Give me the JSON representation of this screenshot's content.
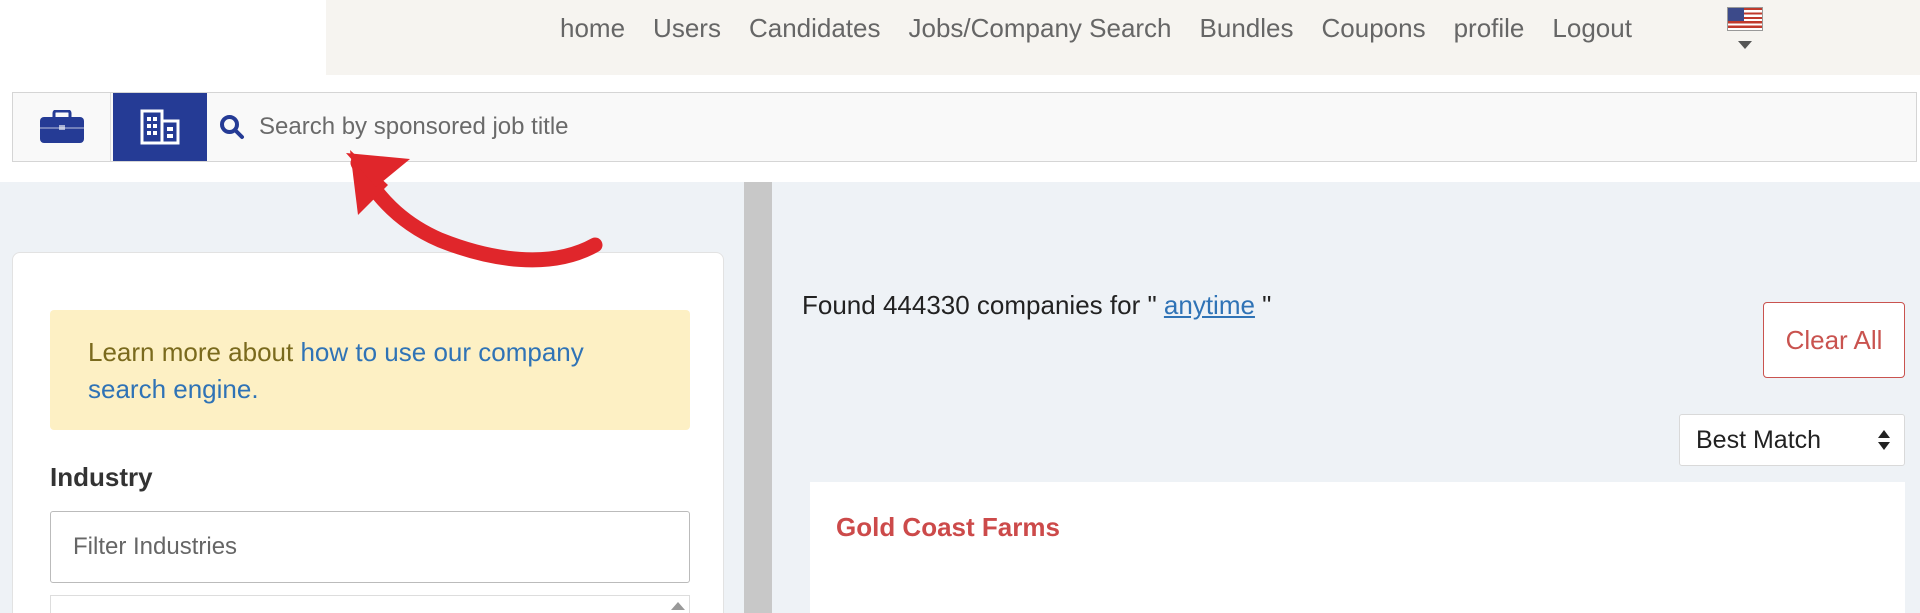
{
  "nav": {
    "items": [
      "home",
      "Users",
      "Candidates",
      "Jobs/Company Search",
      "Bundles",
      "Coupons",
      "profile",
      "Logout"
    ],
    "language_flag_icon": "us-flag-icon",
    "language_dropdown_icon": "caret-down-icon"
  },
  "toolbar": {
    "jobs_icon": "briefcase-icon",
    "company_icon": "building-icon",
    "search_icon": "magnifier-icon",
    "search_placeholder": "Search by sponsored job title",
    "active_color": "#253b95"
  },
  "sidebar": {
    "info_prefix": "Learn more about ",
    "info_link": "how to use our company search engine.",
    "industry_label": "Industry",
    "filter_placeholder": "Filter Industries"
  },
  "results": {
    "found_prefix": "Found 444330 companies for \" ",
    "found_query": "anytime",
    "found_suffix": " \"",
    "clear_all": "Clear All",
    "sort_selected": "Best Match",
    "first_company": "Gold Coast Farms"
  },
  "colors": {
    "brand_blue": "#253b95",
    "link_blue": "#2f73b6",
    "danger_red": "#c9534f",
    "company_name_red": "#cc4a4a",
    "annotation_red": "#e0262b"
  }
}
